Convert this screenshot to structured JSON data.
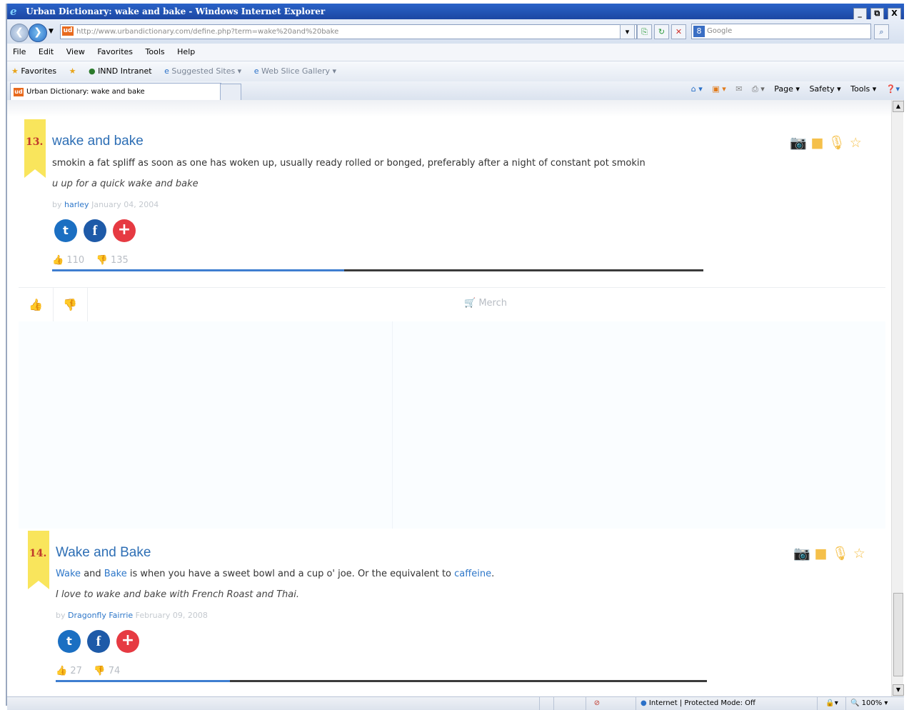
{
  "window": {
    "title": "Urban Dictionary: wake and bake - Windows Internet Explorer",
    "min": "_",
    "max": "⧉",
    "close": "X"
  },
  "address": {
    "url": "http://www.urbandictionary.com/define.php?term=wake%20and%20bake",
    "favicon": "ud",
    "search_placeholder": "Google",
    "search_engine_icon": "8"
  },
  "menu": [
    "File",
    "Edit",
    "View",
    "Favorites",
    "Tools",
    "Help"
  ],
  "favorites_bar": {
    "favorites_label": "Favorites",
    "items": [
      "INND Intranet",
      "Suggested Sites ▾",
      "Web Slice Gallery ▾"
    ]
  },
  "tab": {
    "label": "Urban Dictionary: wake and bake"
  },
  "command_bar": [
    "Page ▾",
    "Safety ▾",
    "Tools ▾"
  ],
  "entries": [
    {
      "rank": "13.",
      "word": "wake and bake",
      "meaning": "smokin a fat spliff as soon as one has woken up, usually ready rolled or bonged, preferably after a night of constant pot smokin",
      "example": "u up for a quick wake and bake",
      "by": "by",
      "author": "harley",
      "date": "January 04, 2004",
      "up": "110",
      "down": "135",
      "up_fraction": 0.449
    },
    {
      "rank": "14.",
      "word": "Wake and Bake",
      "meaning_parts": {
        "link1": "Wake",
        "t1": " and ",
        "link2": "Bake",
        "t2": " is when you have a sweet bowl and a cup o' joe. Or the equivalent to ",
        "link3": "caffeine",
        "t3": "."
      },
      "example": "I love to wake and bake with French Roast and Thai.",
      "by": "by",
      "author": "Dragonfly Fairrie",
      "date": "February 09, 2008",
      "up": "27",
      "down": "74",
      "up_fraction": 0.267
    }
  ],
  "merch_label": "Merch",
  "status": {
    "zone": "Internet | Protected Mode: Off",
    "zoom": "100%"
  },
  "colors": {
    "link": "#2e77c9",
    "ribbon": "#f9e55c",
    "icons": "#f5c04a"
  }
}
